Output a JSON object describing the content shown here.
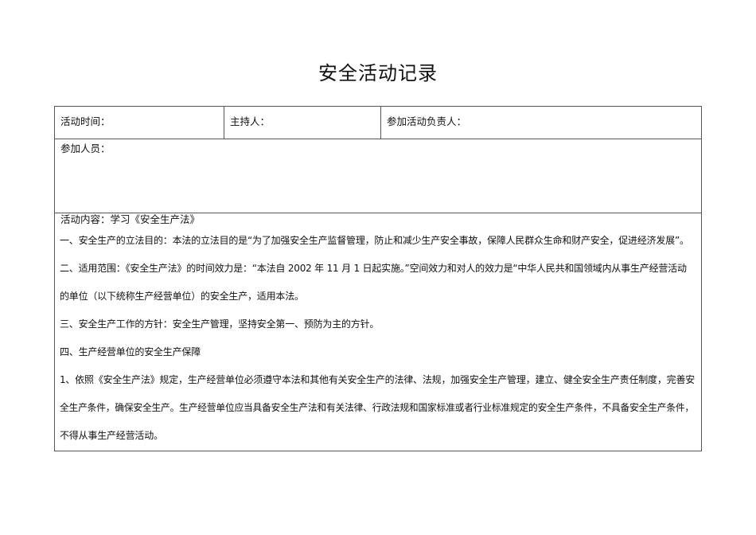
{
  "title": "安全活动记录",
  "table": {
    "row1": {
      "activity_time_label": "活动时间：",
      "host_label": "主持人：",
      "responsible_label": "参加活动负责人："
    },
    "participants_label": "参加人员：",
    "content_heading": "活动内容：学习《安全生产法》",
    "content_lines": [
      "一、安全生产的立法目的：本法的立法目的是“为了加强安全生产监督管理，防止和减少生产安全事故，保障人民群众生命和财产安全，促进经济发展”。",
      "二、适用范围：《安全生产法》的时间效力是：“本法自 2002 年 11 月 1 日起实施。”空间效力和对人的效力是“中华人民共和国领域内从事生产经营活动",
      "的单位（以下统称生产经营单位）的安全生产，适用本法。",
      "三、安全生产工作的方针：安全生产管理，坚持安全第一、预防为主的方针。",
      "四、生产经营单位的安全生产保障",
      "1、依照《安全生产法》规定，生产经营单位必须遵守本法和其他有关安全生产的法律、法规，加强安全生产管理，建立、健全安全生产责任制度，完善安",
      "全生产条件，确保安全生产。生产经营单位应当具备安全生产法和有关法律、行政法规和国家标准或者行业标准规定的安全生产条件，不具备安全生产条件，",
      "不得从事生产经营活动。"
    ]
  }
}
